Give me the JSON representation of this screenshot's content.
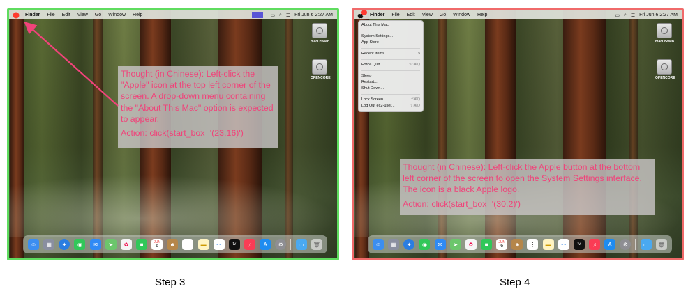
{
  "menubar": {
    "items": [
      "Finder",
      "File",
      "Edit",
      "View",
      "Go",
      "Window",
      "Help"
    ],
    "clock": "Fri Jun 6  2:27 AM"
  },
  "desktop_icons": [
    "macOSweb",
    "OPENCORE"
  ],
  "dock_apps": [
    "finder-icon",
    "launchpad-icon",
    "safari-icon",
    "messages-icon",
    "mail-icon",
    "maps-icon",
    "photos-icon",
    "facetime-icon",
    "calendar-icon",
    "contacts-icon",
    "reminders-icon",
    "notes-icon",
    "freeform-icon",
    "appletv-icon",
    "music-icon",
    "appstore-icon",
    "systemsettings-icon",
    "downloads-icon",
    "trash-icon"
  ],
  "dock_labels": {
    "calendar_month": "JUN",
    "calendar_day": "6",
    "tv": "tv"
  },
  "apple_menu": {
    "groups": [
      [
        {
          "label": "About This Mac",
          "shortcut": ""
        }
      ],
      [
        {
          "label": "System Settings...",
          "shortcut": ""
        },
        {
          "label": "App Store",
          "shortcut": ""
        }
      ],
      [
        {
          "label": "Recent Items",
          "shortcut": ">"
        }
      ],
      [
        {
          "label": "Force Quit...",
          "shortcut": "⌥⌘Q"
        }
      ],
      [
        {
          "label": "Sleep",
          "shortcut": ""
        },
        {
          "label": "Restart...",
          "shortcut": ""
        },
        {
          "label": "Shut Down...",
          "shortcut": ""
        }
      ],
      [
        {
          "label": "Lock Screen",
          "shortcut": "^⌘Q"
        },
        {
          "label": "Log Out ec2-user...",
          "shortcut": "⇧⌘Q"
        }
      ]
    ]
  },
  "step3": {
    "caption": "Step 3",
    "thought": "Thought (in Chinese): Left-click the \"Apple\" icon at the top left corner of the screen. A drop-down menu containing the \"About This Mac\" option is expected to appear.",
    "action": "Action: click(start_box='(23,16)')",
    "status": "success"
  },
  "step4": {
    "caption": "Step 4",
    "thought": "Thought (in Chinese): Left-click the Apple button at the bottom left corner of the screen to open the System Settings interface. The icon is a black Apple logo.",
    "action": "Action: click(start_box='(30,2)')",
    "status": "failure"
  },
  "colors": {
    "success_border": "#5fdc5f",
    "failure_border": "#f06a6a",
    "annotation_text": "#f0437a",
    "click_marker": "#ff3b30"
  }
}
